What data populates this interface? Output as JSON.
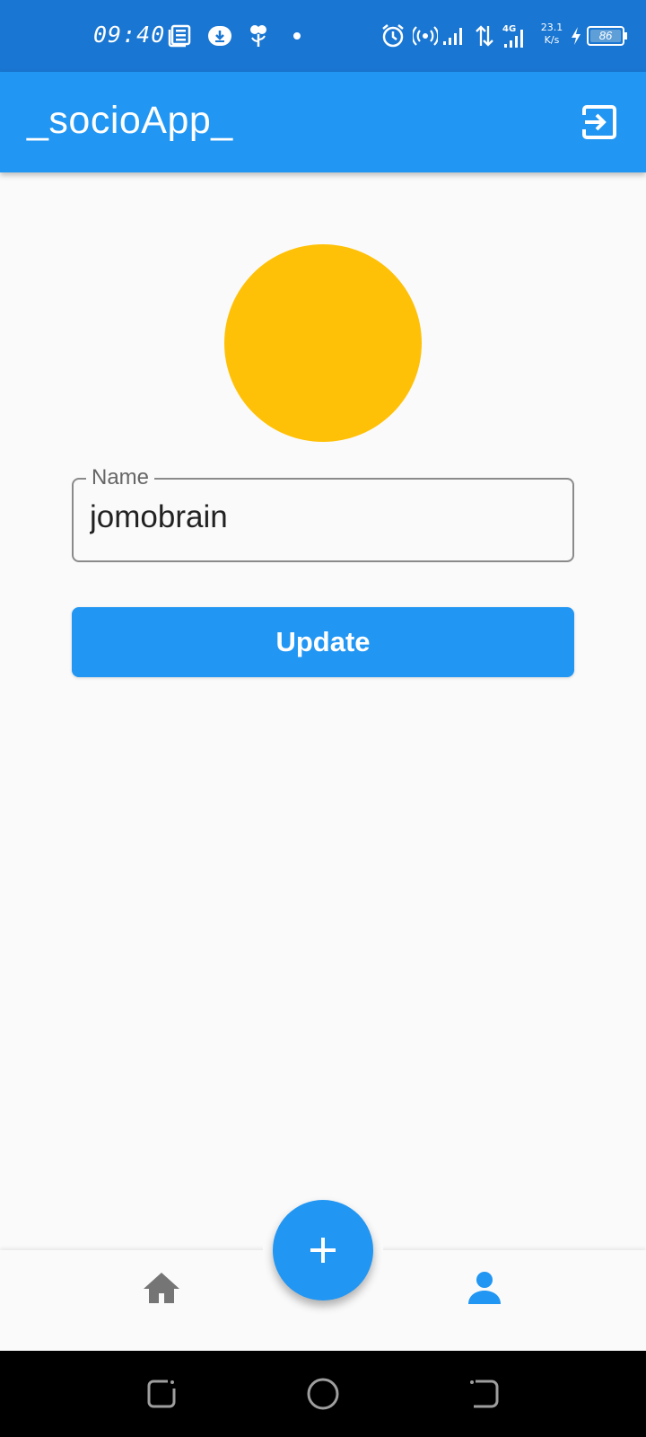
{
  "status_bar": {
    "time": "09:40",
    "network_speed": "23.1",
    "network_speed_unit": "K/s",
    "network_type": "4G",
    "battery": "86",
    "icons": [
      "news-icon",
      "download-icon",
      "flower-icon",
      "dot-icon",
      "alarm-icon",
      "hotspot-icon",
      "signal-icon",
      "data-arrows-icon",
      "signal-4g-icon",
      "charging-icon",
      "battery-icon"
    ]
  },
  "app_bar": {
    "title": "_socioApp_",
    "action_icon": "logout-icon"
  },
  "profile": {
    "avatar_color": "#FFC107",
    "name_label": "Name",
    "name_value": "jomobrain",
    "update_label": "Update"
  },
  "bottom_nav": {
    "items": [
      {
        "icon": "home-icon",
        "active": false
      },
      {
        "icon": "person-icon",
        "active": true
      }
    ],
    "fab_icon": "add-icon"
  },
  "system_nav": {
    "icons": [
      "recent-apps-icon",
      "home-circle-icon",
      "back-icon"
    ]
  },
  "colors": {
    "primary": "#2196F3",
    "status_bar": "#1976D2",
    "avatar": "#FFC107",
    "inactive_icon": "#757575",
    "background": "#FAFAFA"
  }
}
